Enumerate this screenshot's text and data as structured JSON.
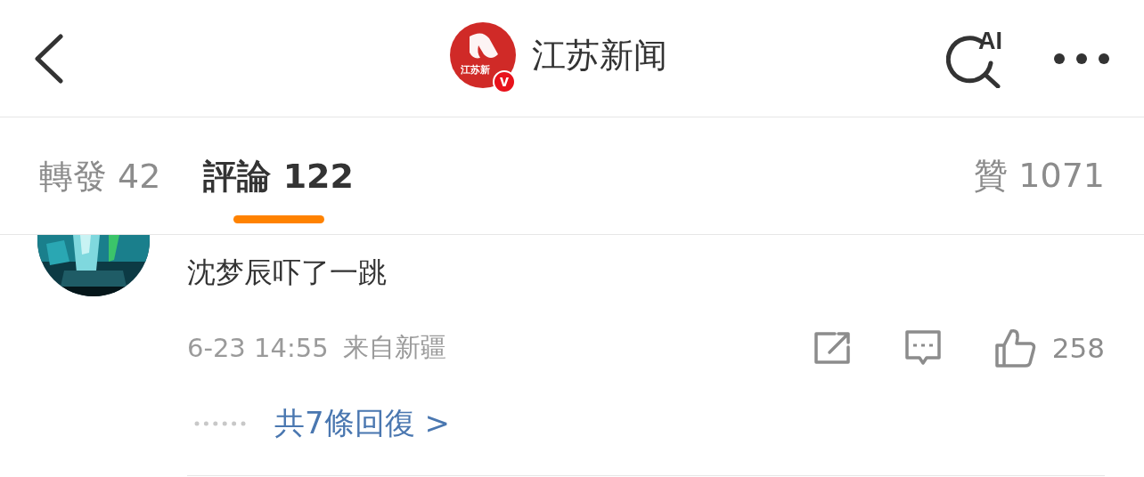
{
  "header": {
    "title": "江苏新闻",
    "logo_text": "江苏新",
    "verified_badge": "v",
    "search_label": "AI"
  },
  "tabs": [
    {
      "label": "轉發 42",
      "selected": false
    },
    {
      "label": "評論 122",
      "selected": true
    }
  ],
  "likes": {
    "label": "贊 1071"
  },
  "comment": {
    "text": "沈梦辰吓了一跳",
    "time": "6-23 14:55",
    "location": "来自新疆",
    "like_count": "258",
    "replies": "共7條回復 >"
  }
}
